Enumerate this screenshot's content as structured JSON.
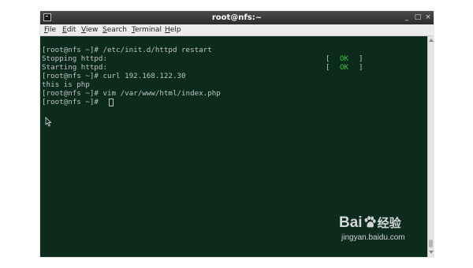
{
  "window": {
    "title": "root@nfs:~",
    "minimize_glyph": "_",
    "maximize_glyph": "□",
    "close_glyph": "×",
    "app_icon": "terminal-icon"
  },
  "menubar": {
    "items": [
      {
        "mnemonic": "F",
        "rest": "ile"
      },
      {
        "mnemonic": "E",
        "rest": "dit"
      },
      {
        "mnemonic": "V",
        "rest": "iew"
      },
      {
        "mnemonic": "S",
        "rest": "earch"
      },
      {
        "mnemonic": "T",
        "rest": "erminal"
      },
      {
        "mnemonic": "H",
        "rest": "elp"
      }
    ]
  },
  "terminal": {
    "lines": [
      "[root@nfs ~]# /etc/init.d/httpd restart",
      "Stopping httpd:",
      "Starting httpd:",
      "[root@nfs ~]# curl 192.168.122.30",
      "this is php",
      "[root@nfs ~]# vim /var/www/html/index.php",
      "[root@nfs ~]# "
    ],
    "status": [
      {
        "open": "[",
        "text": "OK",
        "close": "]"
      },
      {
        "open": "[",
        "text": "OK",
        "close": "]"
      }
    ],
    "colors": {
      "background": "#0d2b1c",
      "text": "#bcc3bf",
      "ok": "#3ec23e"
    }
  },
  "watermark": {
    "logo_left": "Bai",
    "logo_right": "经验",
    "url": "jingyan.baidu.com"
  }
}
